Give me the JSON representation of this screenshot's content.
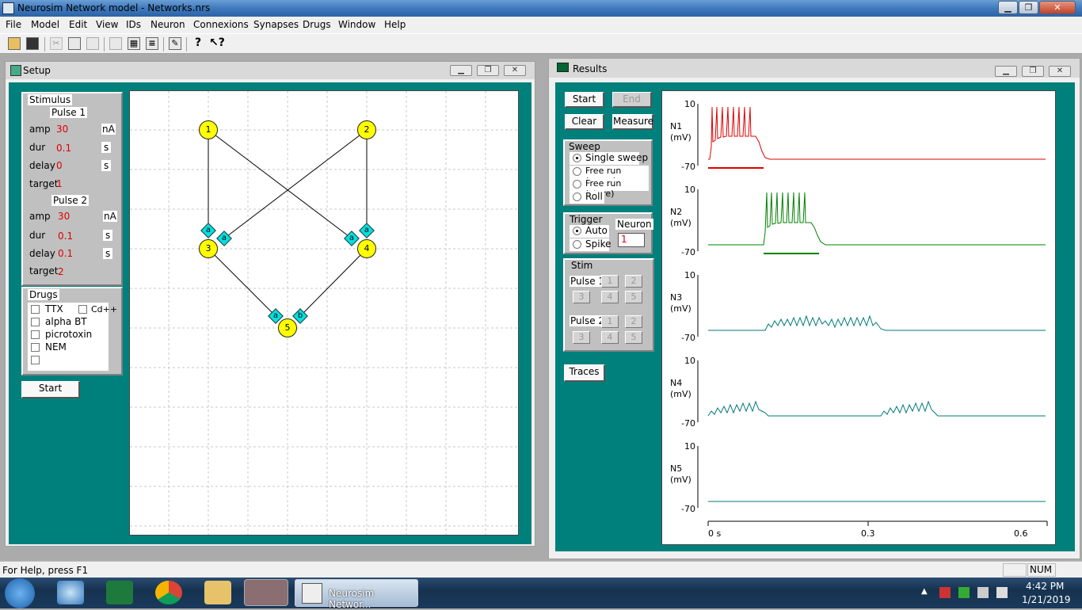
{
  "app": {
    "title": "Neurosim Network model - Networks.nrs",
    "window_controls": {
      "minimize": "▁",
      "restore": "❐",
      "close": "✕"
    }
  },
  "menu": [
    "File",
    "Model",
    "Edit",
    "View",
    "IDs",
    "Neuron",
    "Connexions",
    "Synapses",
    "Drugs",
    "Window",
    "Help"
  ],
  "toolbar_icons": [
    "open-icon",
    "save-icon",
    "cut-icon",
    "copy-icon",
    "paste-icon",
    "print-preview-icon",
    "grid-icon",
    "clipboard-icon",
    "edit-icon",
    "help-icon",
    "context-help-icon"
  ],
  "setup": {
    "title": "Setup",
    "stimulus": {
      "group_label": "Stimulus",
      "pulse1": {
        "label": "Pulse 1",
        "amp_label": "amp",
        "amp": "30",
        "amp_unit": "nA",
        "dur_label": "dur",
        "dur": "0.1",
        "dur_unit": "s",
        "delay_label": "delay",
        "delay": "0",
        "delay_unit": "s",
        "target_label": "target",
        "target": "1"
      },
      "pulse2": {
        "label": "Pulse 2",
        "amp_label": "amp",
        "amp": "30",
        "amp_unit": "nA",
        "dur_label": "dur",
        "dur": "0.1",
        "dur_unit": "s",
        "delay_label": "delay",
        "delay": "0.1",
        "delay_unit": "s",
        "target_label": "target",
        "target": "2"
      }
    },
    "drugs": {
      "group_label": "Drugs",
      "items": [
        "TTX",
        "Cd++",
        "alpha BT",
        "picrotoxin",
        "NEM",
        ""
      ]
    },
    "start_button": "Start",
    "network": {
      "neurons": [
        "1",
        "2",
        "3",
        "4",
        "5"
      ],
      "synapse_labels": [
        "a",
        "a",
        "a",
        "a",
        "a",
        "b"
      ]
    }
  },
  "results": {
    "title": "Results",
    "buttons": {
      "start": "Start",
      "end": "End",
      "clear": "Clear",
      "measure": "Measure",
      "traces": "Traces"
    },
    "sweep": {
      "label": "Sweep",
      "options": [
        "Single sweep",
        "Free run (erase)",
        "Free run (store)",
        "Roll"
      ],
      "selected": "Single sweep"
    },
    "trigger": {
      "label": "Trigger",
      "options": [
        "Auto",
        "Spike"
      ],
      "selected": "Auto",
      "neuron_label": "Neuron",
      "neuron_value": "1"
    },
    "stim": {
      "label": "Stim",
      "pulse1_label": "Pulse 1",
      "pulse2_label": "Pulse 2",
      "numbers": [
        "1",
        "2",
        "3",
        "4",
        "5"
      ]
    },
    "traces": [
      {
        "name": "N1",
        "unit": "(mV)",
        "ymax": "10",
        "ymin": "-70",
        "color": "#e00000"
      },
      {
        "name": "N2",
        "unit": "(mV)",
        "ymax": "10",
        "ymin": "-70",
        "color": "#008000"
      },
      {
        "name": "N3",
        "unit": "(mV)",
        "ymax": "10",
        "ymin": "-70",
        "color": "#007a7a"
      },
      {
        "name": "N4",
        "unit": "(mV)",
        "ymax": "10",
        "ymin": "-70",
        "color": "#007a7a"
      },
      {
        "name": "N5",
        "unit": "(mV)",
        "ymax": "10",
        "ymin": "-70",
        "color": "#007a7a"
      }
    ],
    "x_ticks": [
      "0 s",
      "0.3",
      "0.6"
    ]
  },
  "status": {
    "help_text": "For Help, press F1",
    "num": "NUM"
  },
  "taskbar": {
    "active_app": "Neurosim Networ...",
    "time": "4:42 PM",
    "date": "1/21/2019"
  }
}
